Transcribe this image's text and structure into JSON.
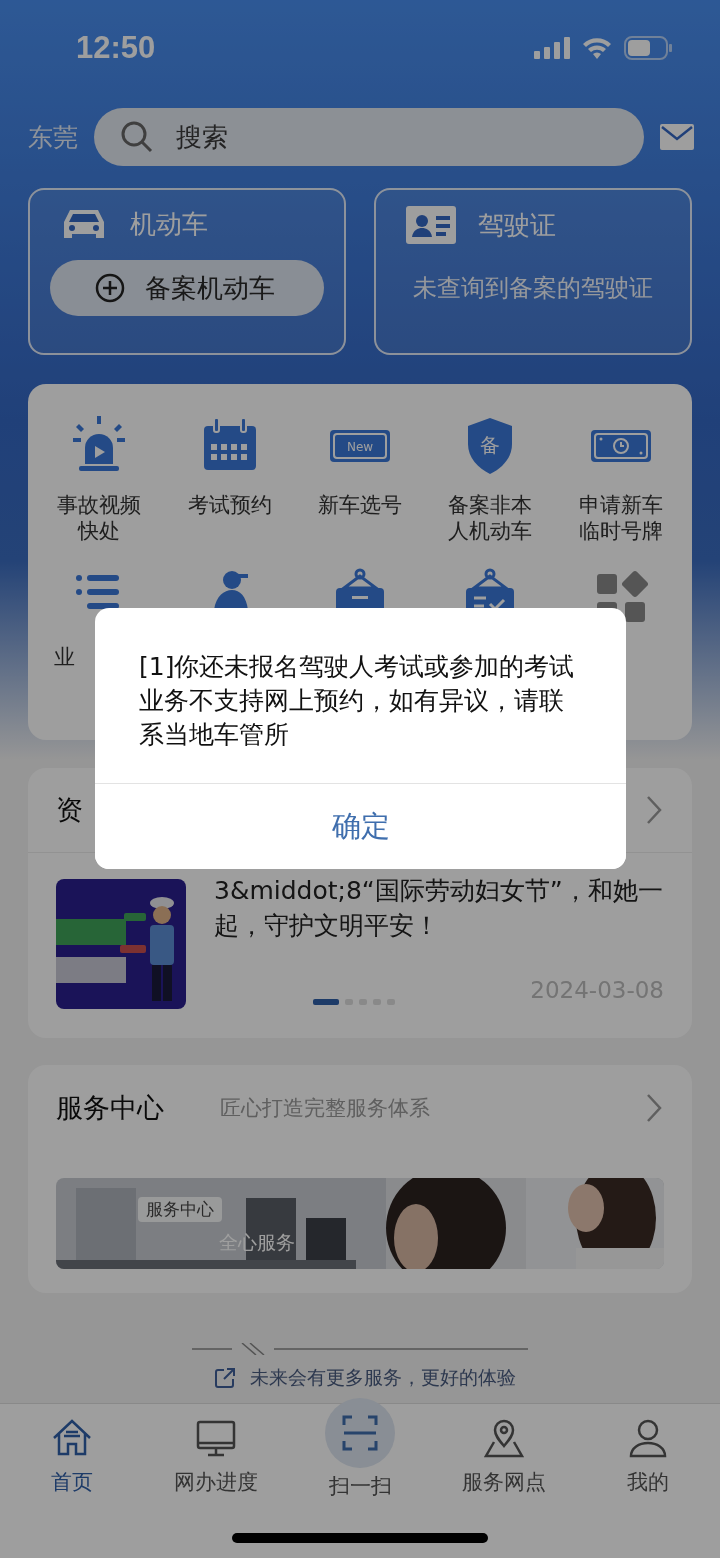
{
  "status_bar": {
    "time": "12:50"
  },
  "header": {
    "city": "东莞",
    "search": {
      "placeholder": "搜索"
    }
  },
  "cards": [
    {
      "kind": "vehicle",
      "title": "机动车",
      "button": "备案机动车"
    },
    {
      "kind": "license",
      "title": "驾驶证",
      "note": "未查询到备案的驾驶证"
    }
  ],
  "services": [
    {
      "kind": "siren",
      "label": "事故视频快处"
    },
    {
      "kind": "calendar",
      "label": "考试预约"
    },
    {
      "kind": "new-plate",
      "glyph": "New",
      "label": "新车选号"
    },
    {
      "kind": "shield",
      "glyph": "备",
      "label": "备案非本人机动车"
    },
    {
      "kind": "clock-plate",
      "label": "申请新车临时号牌"
    },
    {
      "kind": "list",
      "label": "业"
    },
    {
      "kind": "worker"
    },
    {
      "kind": "sign"
    },
    {
      "kind": "sign-check"
    },
    {
      "kind": "apps"
    }
  ],
  "news": {
    "title": "资",
    "text": "3&middot;8“国际劳动妇女节”，和她一起，守护文明平安！",
    "date": "2024-03-08",
    "pages": [
      {
        "selected": true
      },
      {
        "selected": false
      },
      {
        "selected": false
      },
      {
        "selected": false
      },
      {
        "selected": false
      }
    ]
  },
  "service_center": {
    "title": "服务中心",
    "subtitle": "匠心打造完整服务体系",
    "banner": {
      "tag": "服务中心",
      "caption": "全心服务"
    }
  },
  "footer": {
    "text": "未来会有更多服务，更好的体验"
  },
  "tabs": [
    {
      "kind": "home",
      "label": "首页",
      "selected": true
    },
    {
      "kind": "monitor",
      "label": "网办进度",
      "selected": false
    },
    {
      "kind": "scan",
      "label": "扫一扫",
      "selected": false
    },
    {
      "kind": "pin",
      "label": "服务网点",
      "selected": false
    },
    {
      "kind": "person",
      "label": "我的",
      "selected": false
    }
  ],
  "dialog": {
    "message": "[1]你还未报名驾驶人考试或参加的考试业务不支持网上预约，如有异议，请联系当地车管所",
    "button": "确定"
  }
}
